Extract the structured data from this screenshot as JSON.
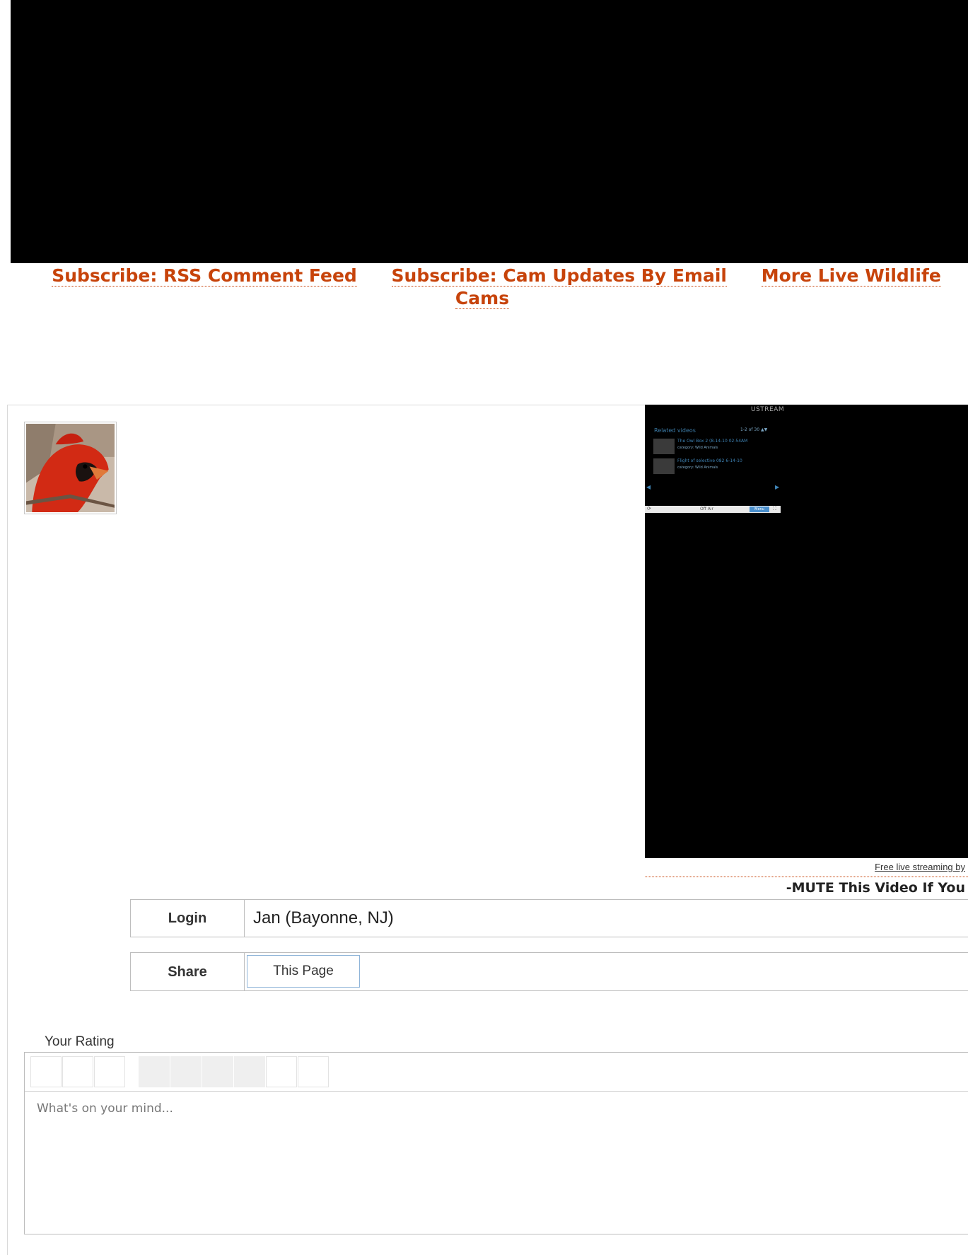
{
  "links": {
    "rss": "Subscribe: RSS Comment Feed",
    "email": "Subscribe: Cam Updates By Email",
    "more": "More Live Wildlife Cams"
  },
  "ustream": {
    "logo": "USTREAM",
    "related_title": "Related videos",
    "related_count": "1-2 of 30",
    "items": [
      {
        "name": "The Owl Box 2 (8-14-10 02:54AM",
        "category": "category: Wild Animals"
      },
      {
        "name": "Flight of selective 082 6-14-10",
        "category": "category: Wild Animals"
      }
    ],
    "status": "Off Air",
    "menu": "Menu"
  },
  "stream_credit": "Free live streaming by",
  "mute_text": "-MUTE This Video If You",
  "login": {
    "label": "Login",
    "value": "Jan (Bayonne, NJ)"
  },
  "share": {
    "label": "Share",
    "button": "This Page"
  },
  "rating": {
    "label": "Your Rating",
    "selected_of_ten": 0
  },
  "comment": {
    "placeholder": "What's on your mind..."
  },
  "colors": {
    "link": "#c7430a",
    "video_bg": "#000000",
    "border": "#bdbdbd"
  }
}
